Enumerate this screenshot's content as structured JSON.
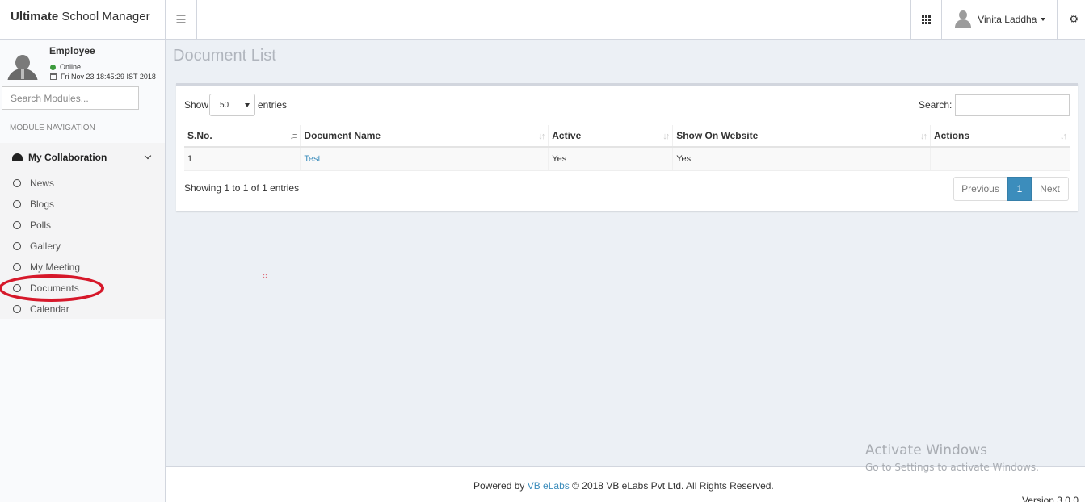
{
  "app": {
    "title_bold": "Ultimate",
    "title_rest": " School Manager"
  },
  "header": {
    "user_name": "Vinita Laddha"
  },
  "sidebar": {
    "role": "Employee",
    "status": "Online",
    "datetime": "Fri Nov 23 18:45:29 IST 2018",
    "search_placeholder": "Search Modules...",
    "nav_heading": "MODULE NAVIGATION",
    "group_label": "My Collaboration",
    "items": [
      {
        "label": "News"
      },
      {
        "label": "Blogs"
      },
      {
        "label": "Polls"
      },
      {
        "label": "Gallery"
      },
      {
        "label": "My Meeting"
      },
      {
        "label": "Documents"
      },
      {
        "label": "Calendar"
      }
    ]
  },
  "main": {
    "title": "Document List",
    "show_label": "Show",
    "entries_value": "50",
    "entries_label": "entries",
    "search_label": "Search:",
    "columns": [
      "S.No.",
      "Document Name",
      "Active",
      "Show On Website",
      "Actions"
    ],
    "rows": [
      {
        "sno": "1",
        "name": "Test",
        "active": "Yes",
        "website": "Yes",
        "actions": ""
      }
    ],
    "info": "Showing 1 to 1 of 1 entries",
    "pager": {
      "prev": "Previous",
      "current": "1",
      "next": "Next"
    }
  },
  "footer": {
    "powered": "Powered by",
    "company_link": "VB eLabs",
    "copyright": "© 2018 VB eLabs Pvt Ltd. All Rights Reserved.",
    "version": "Version 3.0.0"
  },
  "watermark": {
    "title": "Activate Windows",
    "subtitle": "Go to Settings to activate Windows."
  },
  "colors": {
    "accent": "#3c8dbc",
    "highlight": "#d6182a",
    "status_online": "#3c9a3c"
  }
}
